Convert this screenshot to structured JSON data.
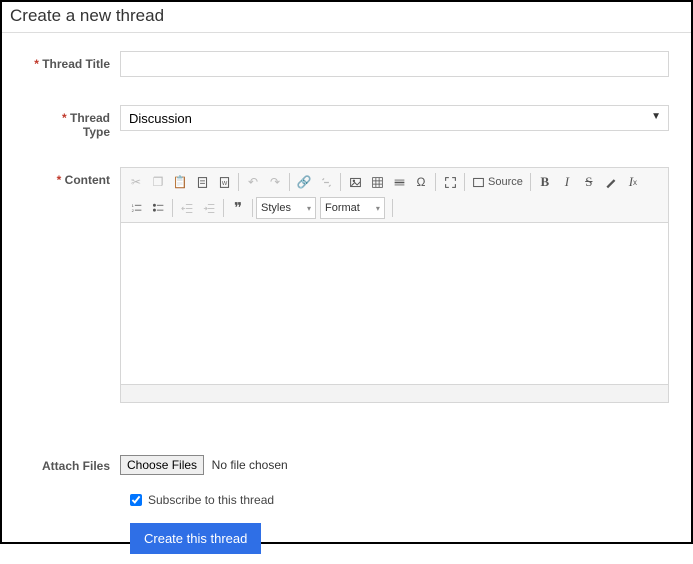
{
  "header": {
    "title": "Create a new thread"
  },
  "labels": {
    "title": "Thread Title",
    "type": "Thread Type",
    "content": "Content",
    "attach": "Attach Files"
  },
  "typeSelect": {
    "value": "Discussion"
  },
  "editor": {
    "source": "Source",
    "styles": "Styles",
    "format": "Format"
  },
  "file": {
    "button": "Choose Files",
    "status": "No file chosen"
  },
  "subscribe": {
    "label": "Subscribe to this thread",
    "checked": true
  },
  "submit": {
    "label": "Create this thread"
  }
}
